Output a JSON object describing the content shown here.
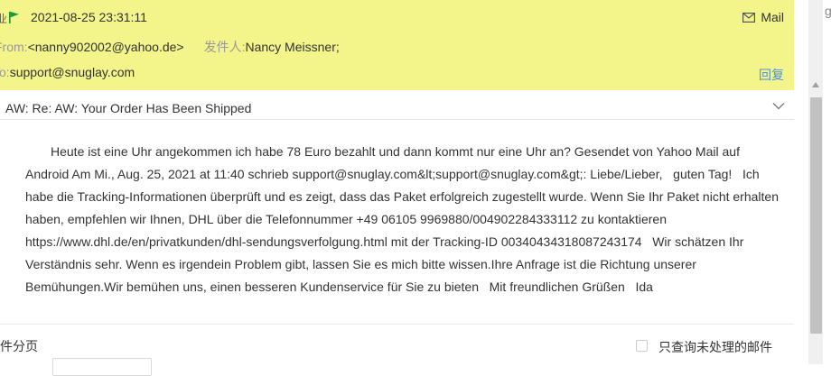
{
  "header": {
    "datetime": "2021-08-25 23:31:11",
    "mail_label": "Mail",
    "from_label": "From:",
    "from_address": "<nanny902002@yahoo.de>",
    "sender_label": "发件人:",
    "sender_name": "Nancy Meissner;",
    "to_label": "To:",
    "to_address": "support@snuglay.com",
    "reply_label": "回复",
    "highlight_color": "#f3f58a"
  },
  "message": {
    "subject": "AW: Re: AW: Your Order Has Been Shipped",
    "body": "Heute ist eine Uhr angekommen ich habe 78 Euro bezahlt und dann kommt nur eine Uhr an? Gesendet von Yahoo Mail auf Android Am Mi., Aug. 25, 2021 at 11:40 schrieb support@snuglay.com&lt;support@snuglay.com&gt;: Liebe/Lieber,   guten Tag!   Ich habe die Tracking-Informationen überprüft und es zeigt, dass das Paket erfolgreich zugestellt wurde. Wenn Sie Ihr Paket nicht erhalten haben, empfehlen wir Ihnen, DHL über die Telefonnummer +49 06105 9969880/004902284333112 zu kontaktieren https://www.dhl.de/en/privatkunden/dhl-sendungsverfolgung.html mit der Tracking-ID 00340434318087243174   Wir schätzen Ihr Verständnis sehr. Wenn es irgendein Problem gibt, lassen Sie es mich bitte wissen.Ihre Anfrage ist die Richtung unserer Bemühungen.Wir bemühen uns, einen besseren Kundenservice für Sie zu bieten   Mit freundlichen Grüßen   Ida"
  },
  "footer": {
    "pager_label": "件分页",
    "filter_label": "只查询未处理的邮件",
    "filter_checked": false
  },
  "icons": {
    "flag": "flag-icon",
    "mail": "mail-envelope-icon",
    "chevron": "chevron-down-icon"
  }
}
